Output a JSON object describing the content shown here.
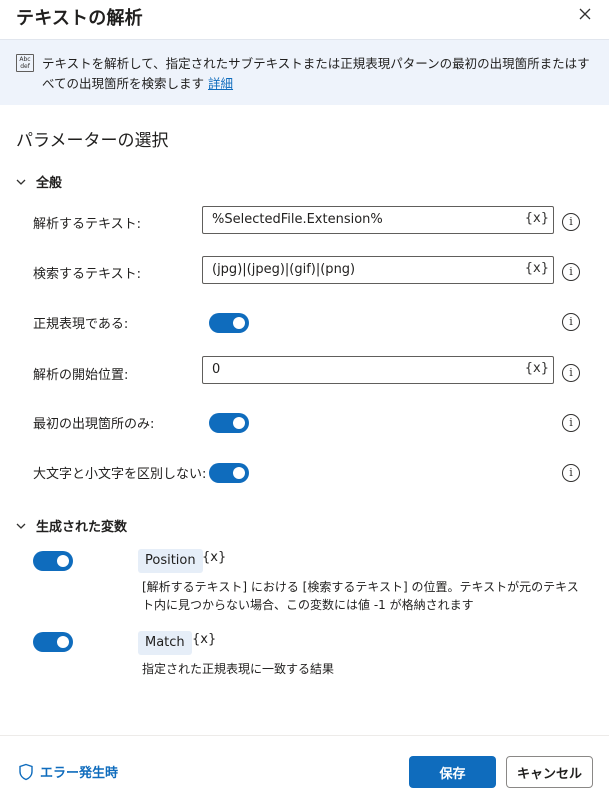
{
  "dialog": {
    "title": "テキストの解析"
  },
  "banner": {
    "icon_text": "Abc def",
    "text": "テキストを解析して、指定されたサブテキストまたは正規表現パターンの最初の出現箇所またはすべての出現箇所を検索します",
    "link": "詳細"
  },
  "section_title": "パラメーターの選択",
  "general": {
    "header": "全般",
    "params": [
      {
        "label": "解析するテキスト:",
        "value": "%SelectedFile.Extension%",
        "var_button": "{x}"
      },
      {
        "label": "検索するテキスト:",
        "value": "(jpg)|(jpeg)|(gif)|(png)",
        "var_button": "{x}"
      },
      {
        "label": "正規表現である:",
        "toggle": true
      },
      {
        "label": "解析の開始位置:",
        "value": "0",
        "var_button": "{x}"
      },
      {
        "label": "最初の出現箇所のみ:",
        "toggle": true
      },
      {
        "label": "大文字と小文字を区別しない:",
        "toggle": true
      }
    ]
  },
  "variables": {
    "header": "生成された変数",
    "items": [
      {
        "name": "Position",
        "x": "{x}",
        "enabled": true,
        "description": "[解析するテキスト] における [検索するテキスト] の位置。テキストが元のテキスト内に見つからない場合、この変数には値 -1 が格納されます"
      },
      {
        "name": "Match",
        "x": "{x}",
        "enabled": true,
        "description": "指定された正規表現に一致する結果"
      }
    ]
  },
  "footer": {
    "error_link": "エラー発生時",
    "save": "保存",
    "cancel": "キャンセル"
  },
  "colors": {
    "accent": "#0f6cbd",
    "banner_bg": "#eef3fb",
    "pill_bg": "#e6eef8"
  }
}
